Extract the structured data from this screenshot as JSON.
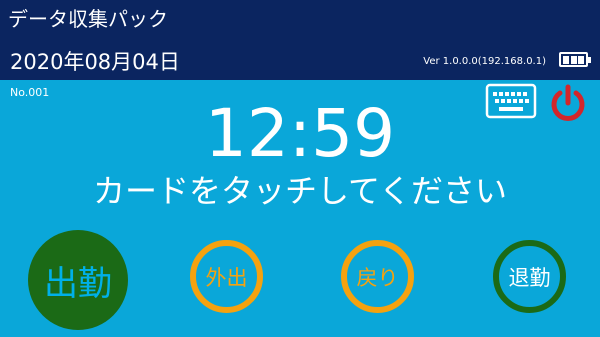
{
  "header": {
    "app_title": "データ収集パック",
    "date": "2020年08月04日",
    "version": "Ver 1.0.0.0(192.168.0.1)",
    "battery_icon": "battery-full-icon"
  },
  "toolbar": {
    "record_no": "No.001",
    "keyboard_icon": "keyboard-icon",
    "power_icon": "power-icon",
    "power_color": "#d3262b"
  },
  "main": {
    "clock": "12:59",
    "prompt": "カードをタッチしてください"
  },
  "buttons": {
    "clock_in": "出勤",
    "go_out": "外出",
    "return": "戻り",
    "clock_out": "退勤"
  },
  "colors": {
    "header_bg": "#0b2560",
    "body_bg": "#0aa7d9",
    "green": "#1b6a16",
    "orange": "#f5a20f"
  }
}
